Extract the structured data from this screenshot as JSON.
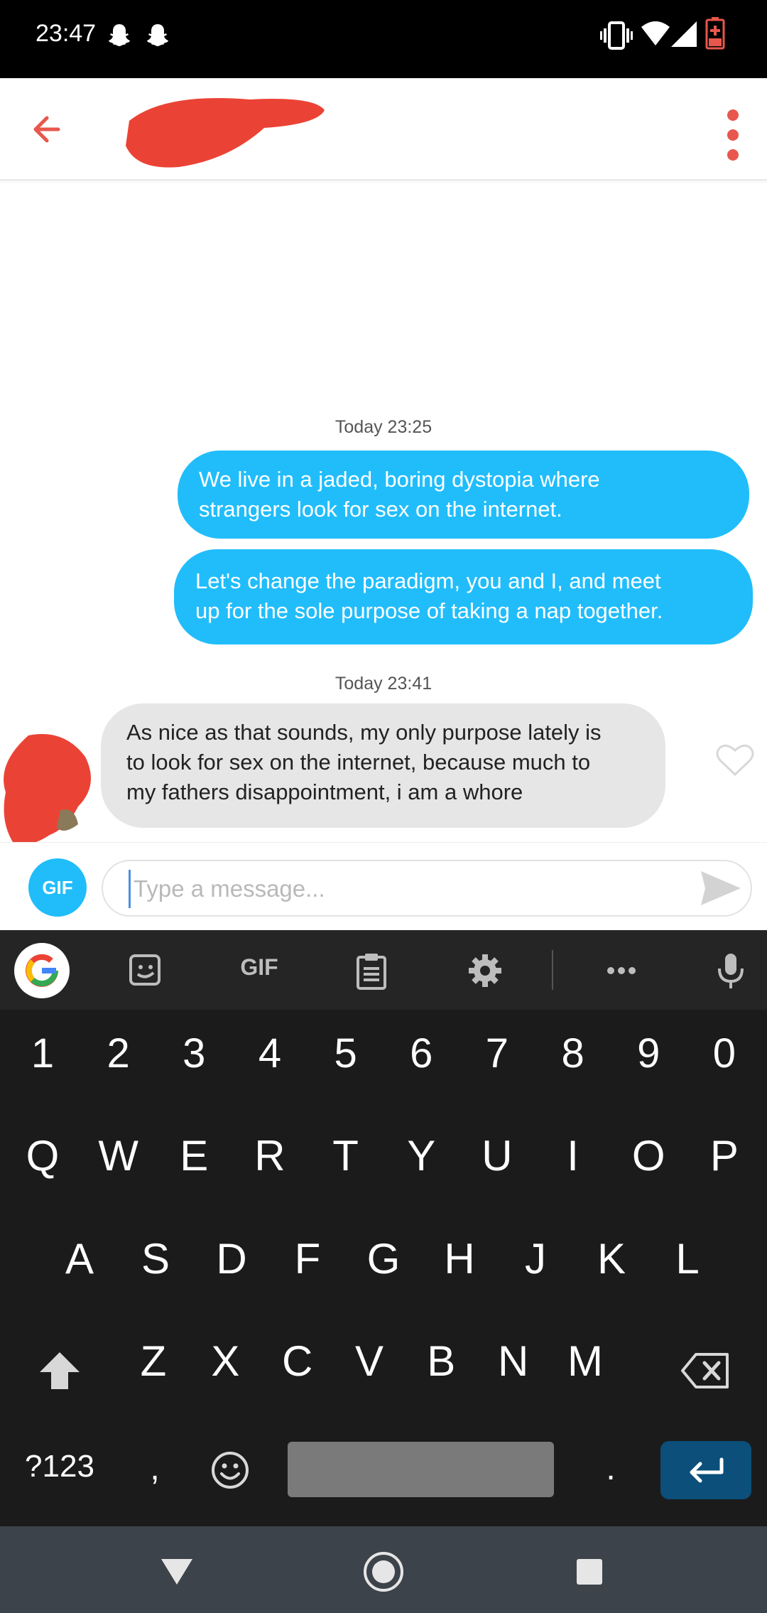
{
  "status_bar": {
    "time": "23:47"
  },
  "header": {
    "back_icon": "arrow-left-icon",
    "menu_icon": "more-vertical-icon",
    "accent_color": "#e8574d"
  },
  "messages": [
    {
      "type": "timestamp",
      "text": "Today 23:25"
    },
    {
      "type": "outgoing",
      "lines": [
        "We live in a jaded, boring dystopia where",
        "strangers look for sex on the internet."
      ]
    },
    {
      "type": "outgoing",
      "lines": [
        "Let's change the paradigm, you and I, and meet",
        "up for the sole purpose of taking a nap together."
      ]
    },
    {
      "type": "timestamp",
      "text": "Today 23:41"
    },
    {
      "type": "incoming",
      "lines": [
        "As nice as that sounds, my only purpose lately is",
        "to look for sex on the internet, because much to",
        "my fathers disappointment, i am a whore"
      ]
    }
  ],
  "composer": {
    "gif_label": "GIF",
    "placeholder": "Type a message..."
  },
  "keyboard": {
    "toolbar_gif": "GIF",
    "number_row": [
      "1",
      "2",
      "3",
      "4",
      "5",
      "6",
      "7",
      "8",
      "9",
      "0"
    ],
    "row1": [
      "Q",
      "W",
      "E",
      "R",
      "T",
      "Y",
      "U",
      "I",
      "O",
      "P"
    ],
    "row2": [
      "A",
      "S",
      "D",
      "F",
      "G",
      "H",
      "J",
      "K",
      "L"
    ],
    "row3": [
      "Z",
      "X",
      "C",
      "V",
      "B",
      "N",
      "M"
    ],
    "symbols_label": "?123",
    "comma": ",",
    "period": "."
  },
  "colors": {
    "outgoing_bubble": "#21bdfb",
    "incoming_bubble": "#e6e6e6",
    "redaction": "#ea4335"
  }
}
